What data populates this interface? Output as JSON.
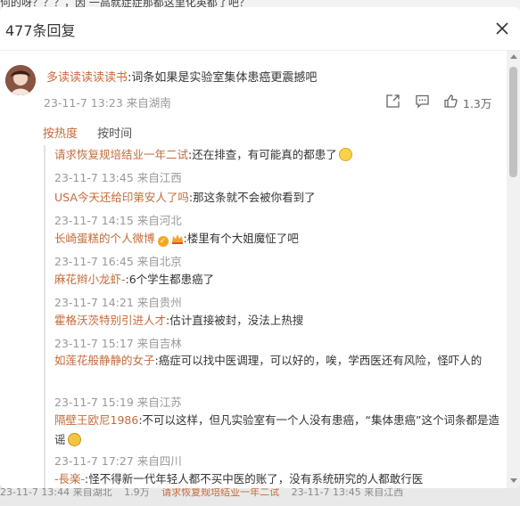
{
  "background": {
    "top_text": "何的呀？？？，因 一高就症症那都这里化英都了吧？",
    "bottom_items": [
      "23-11-7 13:44 来自湖北",
      "1.9万",
      "请求恢复规培结业一年二试",
      "23-11-7 13:45 来自江西"
    ]
  },
  "modal": {
    "title": "477条回复",
    "close_icon": "close-icon"
  },
  "main_comment": {
    "user": "多读读读读读书",
    "text": ":词条如果是实验室集体患癌更震撼吧",
    "time": "23-11-7 13:23",
    "location": "来自湖南",
    "likes": "1.3万",
    "icons": [
      "share-icon",
      "comment-icon",
      "like-icon"
    ]
  },
  "sort_tabs": [
    {
      "label": "按热度",
      "active": true
    },
    {
      "label": "按时间",
      "active": false
    }
  ],
  "replies": [
    {
      "user": "请求恢复规培结业一年二试",
      "text": ":还在排查，有可能真的都患了",
      "emoji": "cry-emoji",
      "meta": "23-11-7 13:45 来自江西"
    },
    {
      "user": "USA今天还给印第安人了吗",
      "text": ":那这条就不会被你看到了",
      "meta": "23-11-7 14:15 来自河北"
    },
    {
      "user": "长崎蛋糕的个人微博",
      "text": ":楼里有个大姐魔怔了吧",
      "badges": [
        "verified-badge-icon",
        "crown-badge-icon"
      ],
      "meta": "23-11-7 16:45 来自北京"
    },
    {
      "user": "麻花辫小龙虾-",
      "text": ":6个学生都患癌了",
      "meta": "23-11-7 14:21 来自贵州"
    },
    {
      "user": "霍格沃茨特别引进人才",
      "text": ":估计直接被封，没法上热搜",
      "meta": "23-11-7 15:17 来自吉林"
    },
    {
      "user": "如莲花般静静的女子",
      "text": ":癌症可以找中医调理，可以好的，唉，学西医还有风险，怪吓人的",
      "meta": "23-11-7 15:19 来自江苏"
    },
    {
      "user": "隔壁王欧尼1986",
      "text": ":不可以这样，但凡实验室有一个人没有患癌，“集体患癌”这个词条都是造谣",
      "emoji": "grin-emoji",
      "meta": "23-11-7 17:27 来自四川"
    },
    {
      "user": "-長楽-",
      "text": ":怪不得新一代年轻人都不买中医的账了，没有系统研究的人都敢行医"
    }
  ]
}
